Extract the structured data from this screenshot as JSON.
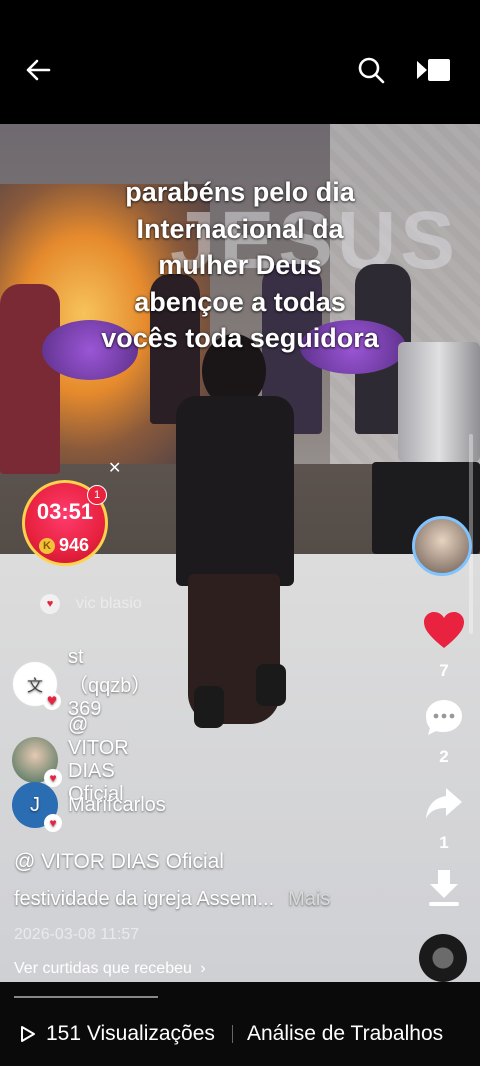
{
  "video_text": {
    "lines": [
      "parabéns pelo dia",
      "Internacional da",
      "mulher Deus",
      "abençoe a todas",
      "vocês toda seguidora"
    ],
    "background_sign": "JESUS"
  },
  "timer": {
    "time": "03:51",
    "coins": "946",
    "coin_icon": "K",
    "badge": "1"
  },
  "rail": {
    "like_count": "7",
    "comment_count": "2",
    "share_count": "1"
  },
  "viewers": [
    {
      "name": "st（qqzb）369"
    },
    {
      "name": "@ VITOR DIAS  Oficial"
    },
    {
      "name": "Marifcarlos",
      "initial": "J"
    }
  ],
  "faded_user": "vic blasio",
  "post": {
    "author": "@ VITOR DIAS  Oficial",
    "description": "festividade da igreja Assem...",
    "more_label": "Mais",
    "date": "2026-03-08 11:57",
    "likes_received": "Ver curtidas que recebeu"
  },
  "footer": {
    "views": "151 Visualizações",
    "analysis": "Análise de Trabalhos"
  },
  "colors": {
    "like_red": "#e8223f",
    "timer_ring": "#ffd14d",
    "avatar_ring": "#7fc3ff"
  }
}
